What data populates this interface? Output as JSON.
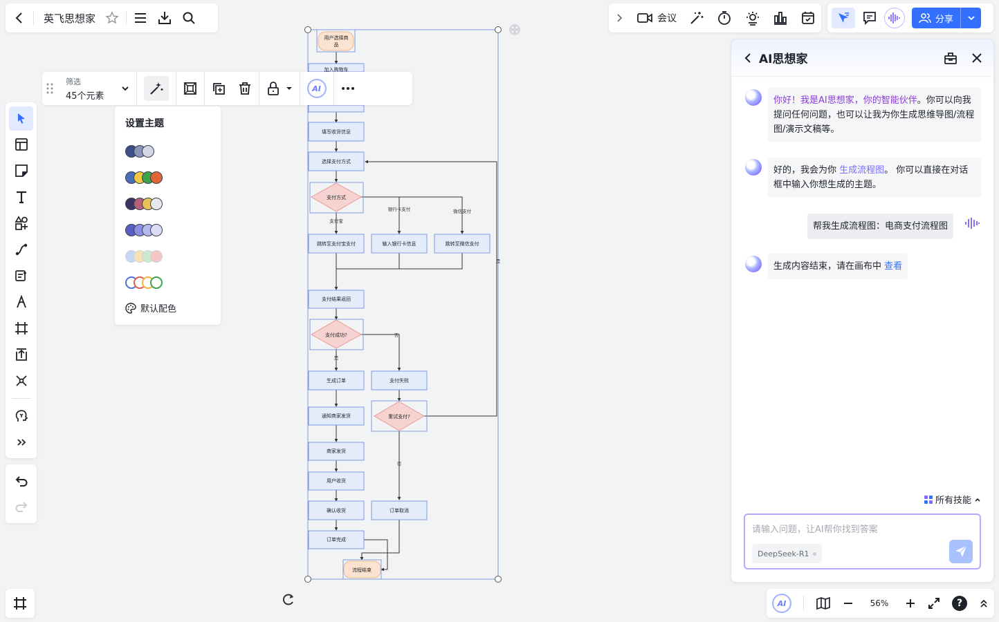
{
  "doc": {
    "title": "英飞思想家"
  },
  "topbar": {
    "meeting_label": "会议",
    "share_label": "分享"
  },
  "selection_toolbar": {
    "filter_label": "筛选",
    "filter_value": "45个元素",
    "ai_label": "AI"
  },
  "theme_popover": {
    "title": "设置主题",
    "swatches": [
      [
        "#3d4f8a",
        "#8a94b8",
        "#d4d8e6"
      ],
      [
        "#4a6fb5",
        "#f2c744",
        "#3fa34d",
        "#e0663a"
      ],
      [
        "#3a3563",
        "#b5617a",
        "#e9c25b",
        "#e6e8ec"
      ],
      [
        "#5a5fc4",
        "#8b8fe0",
        "#b5b8ef",
        "#dcdcf7"
      ],
      [
        "#c8d6f5",
        "#f7e2b8",
        "#cde8cf",
        "#f5c6c6"
      ],
      [
        "#4a6fd8",
        "#e05a4e",
        "#f0b43c",
        "#3fa34d"
      ]
    ],
    "default_label": "默认配色"
  },
  "flowchart": {
    "nodes": {
      "start": "用户选择商品",
      "cart": "加入购物车",
      "address": "填写收货信息",
      "choose_pay": "选择支付方式",
      "pay_method": "支付方式",
      "alipay": "跳转至支付宝支付",
      "bankcard": "输入银行卡信息",
      "wechat": "跳转至微信支付",
      "pay_result": "支付结果返回",
      "pay_ok": "支付成功?",
      "gen_order": "生成订单",
      "pay_fail": "支付失败",
      "notify": "通知商家发货",
      "retry": "重试支付?",
      "ship": "商家发货",
      "receive": "用户收货",
      "confirm": "确认收货",
      "cancel": "订单取消",
      "done": "订单完成",
      "end": "流程结束"
    },
    "edge_labels": {
      "alipay": "支付宝",
      "bankcard": "银行卡支付",
      "wechat": "微信支付",
      "yes": "是",
      "no": "否",
      "retry_yes": "是",
      "retry_no": "否"
    }
  },
  "ai_panel": {
    "title": "AI思想家",
    "messages": {
      "m1_hl": "你好！我是AI思想家，你的智能伙伴",
      "m1_rest": "。你可以向我提问任何问题，也可以让我为你生成思维导图/流程图/演示文稿等。",
      "m2_pre": "好的，我会为你 ",
      "m2_hl": "生成流程图",
      "m2_post": "。 你可以直接在对话框中输入你想生成的主题。",
      "user": "帮我生成流程图：电商支付流程图",
      "m3_pre": "生成内容结束，请在画布中 ",
      "m3_link": "查看"
    },
    "skills_label": "所有技能",
    "input_placeholder": "请输入问题，让AI帮你找到答案",
    "model": "DeepSeek-R1"
  },
  "bottom_bar": {
    "zoom": "56%",
    "ai_label": "AI"
  },
  "colors": {
    "accent": "#3370ff",
    "node_fill": "#e4ebfb",
    "node_stroke": "#7d9be0",
    "diamond_fill": "#f6d3d1",
    "diamond_stroke": "#e89a96",
    "terminal_fill": "#fbe3cf"
  }
}
